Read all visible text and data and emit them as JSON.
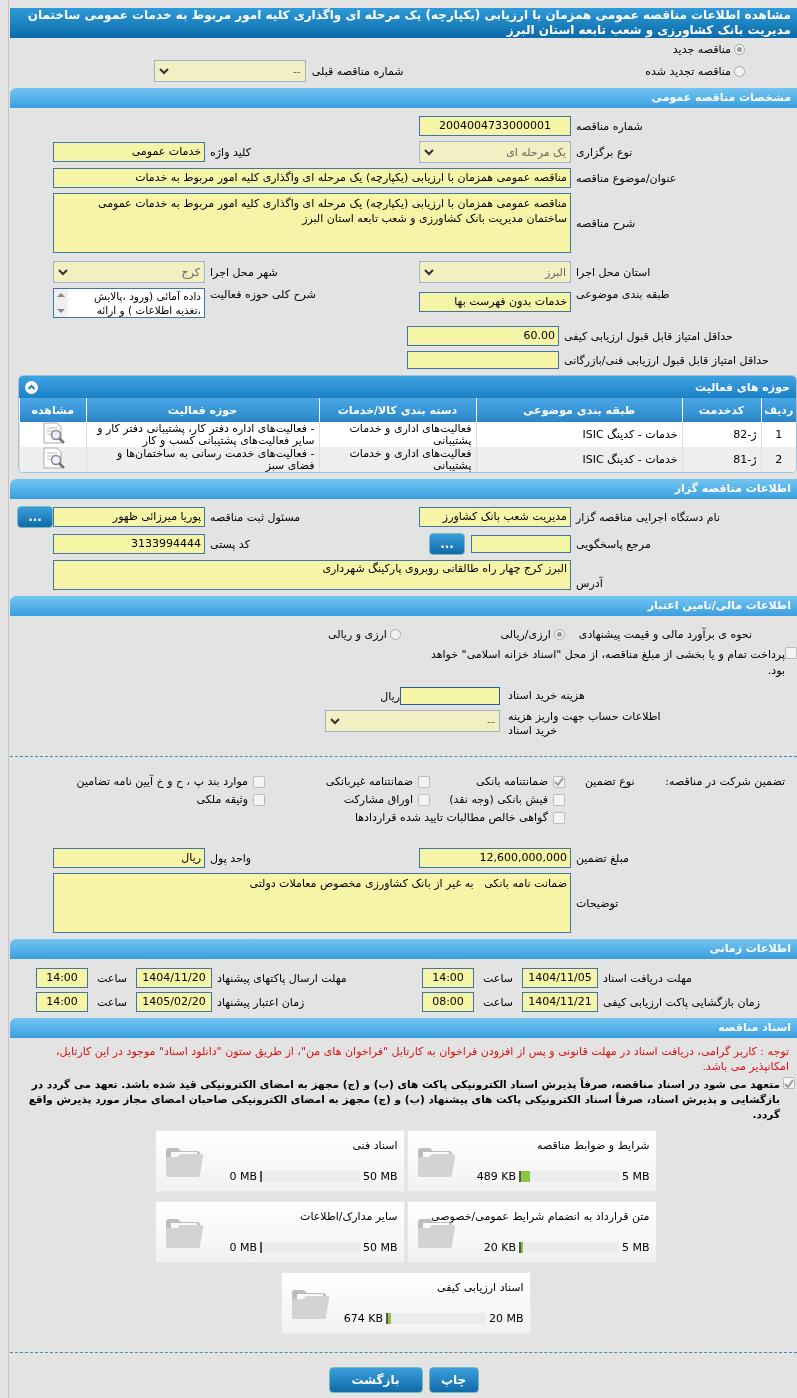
{
  "page_title": "مشاهده اطلاعات مناقصه عمومی همزمان با ارزیابی (یکپارچه) یک مرحله ای واگذاری کلیه امور مربوط به خدمات عمومی ساختمان مدیریت بانک کشاورزی و شعب تابعه استان البرز",
  "tender_kind": [
    {
      "label": "مناقصه جدید",
      "selected": true
    },
    {
      "label": "مناقصه تجدید شده",
      "selected": false
    }
  ],
  "previous_tender": {
    "label": "شماره مناقصه قبلی",
    "value": "--"
  },
  "general": {
    "title": "مشخصات مناقصه عمومی",
    "tender_number": {
      "label": "شماره مناقصه",
      "value": "2004004733000001"
    },
    "holding_type": {
      "label": "نوع برگزاری",
      "value": "یک مرحله ای"
    },
    "keyword": {
      "label": "کلید واژه",
      "value": "خدمات عمومی"
    },
    "subject": {
      "label": "عنوان/موضوع مناقصه",
      "value": "مناقصه عمومی همزمان با ارزیابی (یکپارچه) یک مرحله ای واگذاری کلیه امور مربوط به خدمات"
    },
    "description": {
      "label": "شرح مناقصه",
      "value": "مناقصه عمومی همزمان با ارزیابی (یکپارچه) یک مرحله ای واگذاری کلیه امور مربوط به خدمات عمومی ساختمان مدیریت بانک کشاورزی و شعب تابعه استان البرز"
    },
    "province": {
      "label": "استان محل اجرا",
      "value": "البرز"
    },
    "city": {
      "label": "شهر محل اجرا",
      "value": "کرج"
    },
    "category": {
      "label": "طبقه بندی موضوعی",
      "value": "خدمات بدون فهرست بها"
    },
    "activity_scope": {
      "label": "شرح کلی حوزه فعالیت",
      "lines": [
        "داده آمائی (ورود ،پالایش",
        "،تغذیه اطلاعات ) و ارائه"
      ]
    },
    "min_quality_score": {
      "label": "حداقل امتیاز قابل قبول ارزیابی کیفی",
      "value": "60.00"
    },
    "min_technical_score": {
      "label": "حداقل امتیاز قابل قبول ارزیابی فنی/بازرگانی"
    }
  },
  "activities": {
    "title": "حوزه های فعالیت",
    "columns": [
      "ردیف",
      "کدخدمت",
      "طبقه بندی موضوعی",
      "دسته بندی کالا/خدمات",
      "حوزه فعالیت",
      "مشاهده"
    ],
    "rows": [
      {
        "row": "1",
        "code": "ژ-82",
        "category": "خدمات - کدینگ ISIC",
        "group": "فعالیت‌های اداری و خدمات پشتیبانی",
        "scope": "- فعالیت‌های  اداره دفتر کار، پشتیبانی دفتر کار و سایر  فعالیت‌های پشتیبانی کسب و کار"
      },
      {
        "row": "2",
        "code": "ژ-81",
        "category": "خدمات - کدینگ ISIC",
        "group": "فعالیت‌های اداری و خدمات پشتیبانی",
        "scope": "- فعالیت‌های خدمت رسانی به ساختمان‌ها و فضای سبز"
      }
    ]
  },
  "organizer": {
    "title": "اطلاعات مناقصه گزار",
    "agency": {
      "label": "نام دستگاه اجرایی مناقصه گزار",
      "value": "مدیریت شعب بانک کشاورز"
    },
    "registrar": {
      "label": "مسئول ثبت مناقصه",
      "value": "پوریا میرزائی ظهور"
    },
    "registrar_button": "...",
    "reference": {
      "label": "مرجع پاسخگویی"
    },
    "reference_button": "...",
    "postal_code": {
      "label": "کد پستی",
      "value": "3133994444"
    },
    "address": {
      "label": "آدرس",
      "value": "البرز کرج چهار راه طالقانی روبروی پارکینگ شهرداری"
    }
  },
  "finance": {
    "title": "اطلاعات مالی/تامین اعتبار",
    "estimate_label": "نحوه ی برآورد مالی و قیمت پیشنهادی",
    "estimate_options": [
      {
        "label": "ارزی/ریالی",
        "selected": true
      },
      {
        "label": "ارزی و ریالی",
        "selected": false
      }
    ],
    "treasury": {
      "label": "پرداخت تمام و یا بخشی از مبلغ مناقصه، از محل \"اسناد خزانه اسلامی\" خواهد بود.",
      "checked": false
    },
    "document_fee": {
      "label": "هزینه خرید اسناد",
      "unit": "ریال"
    },
    "account": {
      "label": "اطلاعات حساب جهت واریز هزینه خرید اسناد",
      "value": "--"
    }
  },
  "guarantee": {
    "label": "تضمین شرکت در مناقصه:",
    "type_label": "نوع تضمین",
    "options": [
      {
        "label": "ضمانتنامه بانکی",
        "checked": true
      },
      {
        "label": "ضمانتنامه غیربانکی",
        "checked": false
      },
      {
        "label": "موارد بند پ ، ح و خ آیین نامه تضامین",
        "checked": false
      },
      {
        "label": "فیش بانکی (وجه نقد)",
        "checked": false
      },
      {
        "label": "اوراق مشارکت",
        "checked": false
      },
      {
        "label": "وثیقه ملکی",
        "checked": false
      },
      {
        "label": "گواهی خالص مطالبات تایید شده قراردادها",
        "checked": false
      }
    ],
    "amount": {
      "label": "مبلغ تضمین",
      "value": "12,600,000,000"
    },
    "currency": {
      "label": "واحد پول",
      "value": "ریال"
    },
    "notes": {
      "label": "توضیحات",
      "value": "ضمانت نامه بانکی   به غیر از بانک کشاورزی مخصوص معاملات دولتی"
    }
  },
  "timing": {
    "title": "اطلاعات زمانی",
    "items": [
      {
        "label": "مهلت دریافت اسناد",
        "date": "1404/11/05",
        "time_label": "ساعت",
        "time": "14:00"
      },
      {
        "label": "مهلت ارسال پاکتهای پیشنهاد",
        "date": "1404/11/20",
        "time_label": "ساعت",
        "time": "14:00"
      },
      {
        "label": "زمان بازگشایی پاکت ارزیابی کیفی",
        "date": "1404/11/21",
        "time_label": "ساعت",
        "time": "08:00"
      },
      {
        "label": "زمان اعتبار پیشنهاد",
        "date": "1405/02/20",
        "time_label": "ساعت",
        "time": "14:00"
      }
    ]
  },
  "documents": {
    "title": "اسناد مناقصه",
    "notice": "توجه : کاربر گرامی، دریافت اسناد در مهلت قانونی و پس از افزودن فراخوان به کارتابل \"فراخوان های من\"، از طریق ستون \"دانلود اسناد\" موجود در این کارتابل، امکانپذیر می باشد.",
    "commitment": {
      "text": "متعهد می شود در اسناد مناقصه، صرفاً پذیرش اسناد الکترونیکی پاکت های (ب) و (ج) مجهز به امضای الکترونیکی قید شده باشد. تعهد می گردد در بازگشایی و پذیرش اسناد، صرفاً اسناد الکترونیکی پاکت های پیشنهاد (ب) و (ج) مجهز به امضای الکترونیکی صاحبان امضای مجاز مورد پذیرش واقع گردد.",
      "checked": true
    },
    "files": [
      {
        "name": "شرایط و ضوابط مناقصه",
        "used": "489 KB",
        "limit": "5 MB",
        "level": 0.095
      },
      {
        "name": "اسناد فنی",
        "used": "0 MB",
        "limit": "50 MB",
        "level": 0
      },
      {
        "name": "متن قرارداد به انضمام شرایط عمومی/خصوصی",
        "used": "20 KB",
        "limit": "5 MB",
        "level": 0.02
      },
      {
        "name": "سایر مدارک/اطلاعات",
        "used": "0 MB",
        "limit": "50 MB",
        "level": 0
      },
      {
        "name": "اسناد ارزیابی کیفی",
        "used": "674 KB",
        "limit": "20 MB",
        "level": 0.033
      }
    ]
  },
  "buttons": {
    "print": "چاپ",
    "back": "بازگشت"
  }
}
